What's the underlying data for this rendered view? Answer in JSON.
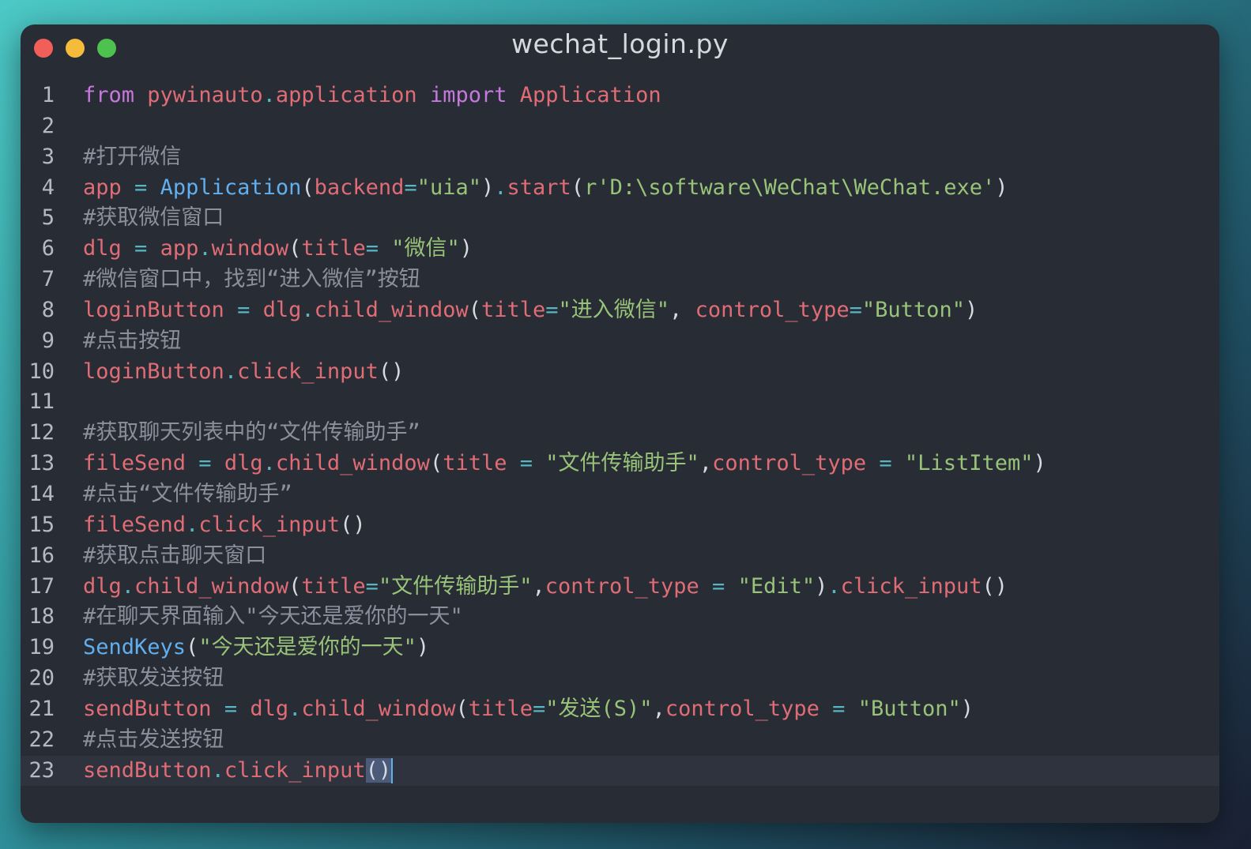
{
  "window": {
    "title": "wechat_login.py",
    "controls": [
      "close-icon",
      "minimize-icon",
      "maximize-icon"
    ],
    "colors": {
      "close": "#f25f58",
      "minimize": "#f5bc3b",
      "maximize": "#4ec24e",
      "background": "#282c35"
    }
  },
  "editor": {
    "active_line": 23,
    "lines": [
      {
        "n": "1",
        "tokens": [
          {
            "t": "from",
            "c": "kw"
          },
          {
            "t": " ",
            "c": "pun"
          },
          {
            "t": "pywinauto",
            "c": "var"
          },
          {
            "t": ".",
            "c": "op"
          },
          {
            "t": "application",
            "c": "var"
          },
          {
            "t": " ",
            "c": "pun"
          },
          {
            "t": "import",
            "c": "kw"
          },
          {
            "t": " ",
            "c": "pun"
          },
          {
            "t": "Application",
            "c": "var"
          }
        ]
      },
      {
        "n": "2",
        "tokens": []
      },
      {
        "n": "3",
        "tokens": [
          {
            "t": "#打开微信",
            "c": "com"
          }
        ]
      },
      {
        "n": "4",
        "tokens": [
          {
            "t": "app",
            "c": "var"
          },
          {
            "t": " = ",
            "c": "op"
          },
          {
            "t": "Application",
            "c": "cls"
          },
          {
            "t": "(",
            "c": "pun"
          },
          {
            "t": "backend",
            "c": "var"
          },
          {
            "t": "=",
            "c": "op"
          },
          {
            "t": "\"uia\"",
            "c": "str"
          },
          {
            "t": ")",
            "c": "pun"
          },
          {
            "t": ".",
            "c": "op"
          },
          {
            "t": "start",
            "c": "var"
          },
          {
            "t": "(",
            "c": "pun"
          },
          {
            "t": "r'D:\\software\\WeChat\\WeChat.exe'",
            "c": "str"
          },
          {
            "t": ")",
            "c": "pun"
          }
        ]
      },
      {
        "n": "5",
        "tokens": [
          {
            "t": "#获取微信窗口",
            "c": "com"
          }
        ]
      },
      {
        "n": "6",
        "tokens": [
          {
            "t": "dlg",
            "c": "var"
          },
          {
            "t": " = ",
            "c": "op"
          },
          {
            "t": "app",
            "c": "var"
          },
          {
            "t": ".",
            "c": "op"
          },
          {
            "t": "window",
            "c": "var"
          },
          {
            "t": "(",
            "c": "pun"
          },
          {
            "t": "title",
            "c": "var"
          },
          {
            "t": "= ",
            "c": "op"
          },
          {
            "t": "\"微信\"",
            "c": "str"
          },
          {
            "t": ")",
            "c": "pun"
          }
        ]
      },
      {
        "n": "7",
        "tokens": [
          {
            "t": "#微信窗口中，找到“进入微信”按钮",
            "c": "com"
          }
        ]
      },
      {
        "n": "8",
        "tokens": [
          {
            "t": "loginButton",
            "c": "var"
          },
          {
            "t": " = ",
            "c": "op"
          },
          {
            "t": "dlg",
            "c": "var"
          },
          {
            "t": ".",
            "c": "op"
          },
          {
            "t": "child_window",
            "c": "var"
          },
          {
            "t": "(",
            "c": "pun"
          },
          {
            "t": "title",
            "c": "var"
          },
          {
            "t": "=",
            "c": "op"
          },
          {
            "t": "\"进入微信\"",
            "c": "str"
          },
          {
            "t": ", ",
            "c": "pun"
          },
          {
            "t": "control_type",
            "c": "var"
          },
          {
            "t": "=",
            "c": "op"
          },
          {
            "t": "\"Button\"",
            "c": "str"
          },
          {
            "t": ")",
            "c": "pun"
          }
        ]
      },
      {
        "n": "9",
        "tokens": [
          {
            "t": "#点击按钮",
            "c": "com"
          }
        ]
      },
      {
        "n": "10",
        "tokens": [
          {
            "t": "loginButton",
            "c": "var"
          },
          {
            "t": ".",
            "c": "op"
          },
          {
            "t": "click_input",
            "c": "var"
          },
          {
            "t": "()",
            "c": "pun"
          }
        ]
      },
      {
        "n": "11",
        "tokens": []
      },
      {
        "n": "12",
        "tokens": [
          {
            "t": "#获取聊天列表中的“文件传输助手”",
            "c": "com"
          }
        ]
      },
      {
        "n": "13",
        "tokens": [
          {
            "t": "fileSend",
            "c": "var"
          },
          {
            "t": " = ",
            "c": "op"
          },
          {
            "t": "dlg",
            "c": "var"
          },
          {
            "t": ".",
            "c": "op"
          },
          {
            "t": "child_window",
            "c": "var"
          },
          {
            "t": "(",
            "c": "pun"
          },
          {
            "t": "title",
            "c": "var"
          },
          {
            "t": " = ",
            "c": "op"
          },
          {
            "t": "\"文件传输助手\"",
            "c": "str"
          },
          {
            "t": ",",
            "c": "pun"
          },
          {
            "t": "control_type",
            "c": "var"
          },
          {
            "t": " = ",
            "c": "op"
          },
          {
            "t": "\"ListItem\"",
            "c": "str"
          },
          {
            "t": ")",
            "c": "pun"
          }
        ]
      },
      {
        "n": "14",
        "tokens": [
          {
            "t": "#点击“文件传输助手”",
            "c": "com"
          }
        ]
      },
      {
        "n": "15",
        "tokens": [
          {
            "t": "fileSend",
            "c": "var"
          },
          {
            "t": ".",
            "c": "op"
          },
          {
            "t": "click_input",
            "c": "var"
          },
          {
            "t": "()",
            "c": "pun"
          }
        ]
      },
      {
        "n": "16",
        "tokens": [
          {
            "t": "#获取点击聊天窗口",
            "c": "com"
          }
        ]
      },
      {
        "n": "17",
        "tokens": [
          {
            "t": "dlg",
            "c": "var"
          },
          {
            "t": ".",
            "c": "op"
          },
          {
            "t": "child_window",
            "c": "var"
          },
          {
            "t": "(",
            "c": "pun"
          },
          {
            "t": "title",
            "c": "var"
          },
          {
            "t": "=",
            "c": "op"
          },
          {
            "t": "\"文件传输助手\"",
            "c": "str"
          },
          {
            "t": ",",
            "c": "pun"
          },
          {
            "t": "control_type",
            "c": "var"
          },
          {
            "t": " = ",
            "c": "op"
          },
          {
            "t": "\"Edit\"",
            "c": "str"
          },
          {
            "t": ")",
            "c": "pun"
          },
          {
            "t": ".",
            "c": "op"
          },
          {
            "t": "click_input",
            "c": "var"
          },
          {
            "t": "()",
            "c": "pun"
          }
        ]
      },
      {
        "n": "18",
        "tokens": [
          {
            "t": "#在聊天界面输入\"今天还是爱你的一天\"",
            "c": "com"
          }
        ]
      },
      {
        "n": "19",
        "tokens": [
          {
            "t": "SendKeys",
            "c": "cls"
          },
          {
            "t": "(",
            "c": "pun"
          },
          {
            "t": "\"今天还是爱你的一天\"",
            "c": "str"
          },
          {
            "t": ")",
            "c": "pun"
          }
        ]
      },
      {
        "n": "20",
        "tokens": [
          {
            "t": "#获取发送按钮",
            "c": "com"
          }
        ]
      },
      {
        "n": "21",
        "tokens": [
          {
            "t": "sendButton",
            "c": "var"
          },
          {
            "t": " = ",
            "c": "op"
          },
          {
            "t": "dlg",
            "c": "var"
          },
          {
            "t": ".",
            "c": "op"
          },
          {
            "t": "child_window",
            "c": "var"
          },
          {
            "t": "(",
            "c": "pun"
          },
          {
            "t": "title",
            "c": "var"
          },
          {
            "t": "=",
            "c": "op"
          },
          {
            "t": "\"发送(S)\"",
            "c": "str"
          },
          {
            "t": ",",
            "c": "pun"
          },
          {
            "t": "control_type",
            "c": "var"
          },
          {
            "t": " = ",
            "c": "op"
          },
          {
            "t": "\"Button\"",
            "c": "str"
          },
          {
            "t": ")",
            "c": "pun"
          }
        ]
      },
      {
        "n": "22",
        "tokens": [
          {
            "t": "#点击发送按钮",
            "c": "com"
          }
        ]
      },
      {
        "n": "23",
        "tokens": [
          {
            "t": "sendButton",
            "c": "var"
          },
          {
            "t": ".",
            "c": "op"
          },
          {
            "t": "click_input",
            "c": "var"
          },
          {
            "t": "()",
            "c": "sel"
          }
        ]
      }
    ]
  }
}
